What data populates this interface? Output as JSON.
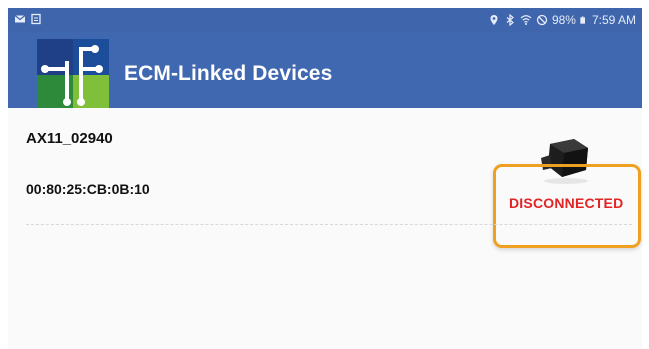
{
  "status_bar": {
    "battery": "98%",
    "time": "7:59 AM",
    "icons": [
      "mail-icon",
      "sync-icon",
      "location-icon",
      "bluetooth-icon",
      "wifi-icon",
      "do-not-disturb-icon",
      "battery-icon"
    ]
  },
  "app_bar": {
    "title": "ECM-Linked Devices",
    "logo": "circuit-logo-icon"
  },
  "devices": [
    {
      "name": "AX11_02940",
      "mac": "00:80:25:CB:0B:10",
      "status": "DISCONNECTED",
      "status_color": "#e22424",
      "device_icon": "obd-adapter-icon"
    }
  ],
  "colors": {
    "app_bar": "#4068b0",
    "highlight": "#f0a020"
  }
}
